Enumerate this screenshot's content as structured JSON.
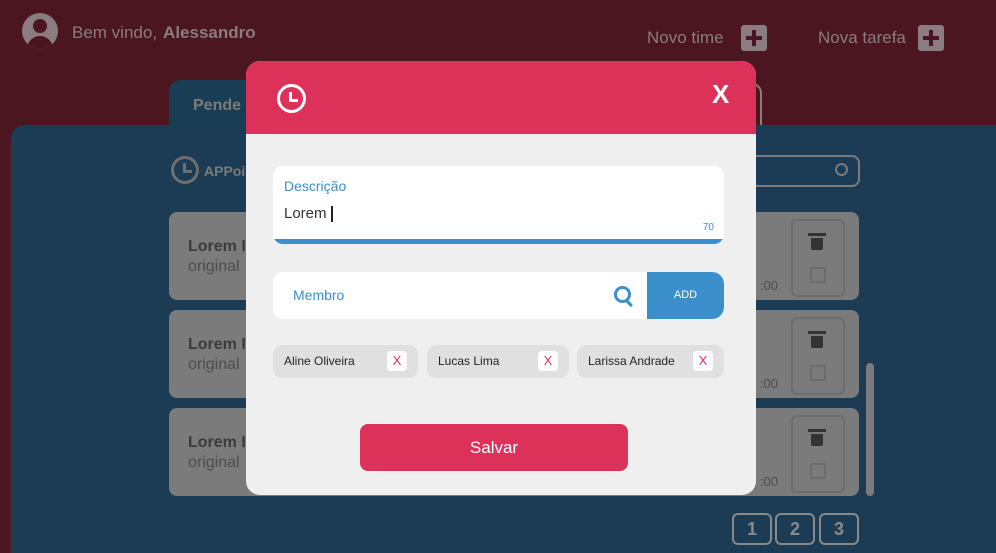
{
  "header": {
    "welcome_prefix": "Bem vindo,",
    "user_name": "Alessandro",
    "new_team_label": "Novo time",
    "new_task_label": "Nova tarefa"
  },
  "tabs": {
    "active_label": "Pende"
  },
  "app": {
    "name": "APPoi"
  },
  "cards": [
    {
      "title": "Lorem I",
      "subtitle": "original",
      "time": ":00"
    },
    {
      "title": "Lorem I",
      "subtitle": "original",
      "time": ":00"
    },
    {
      "title": "Lorem I",
      "subtitle": "original",
      "time": ":00"
    }
  ],
  "pagination": [
    "1",
    "2",
    "3"
  ],
  "modal": {
    "close_label": "X",
    "description_label": "Descrição",
    "description_value": "Lorem",
    "char_count": "70",
    "member_placeholder": "Membro",
    "add_label": "ADD",
    "members": [
      {
        "name": "Aline Oliveira",
        "remove": "X"
      },
      {
        "name": "Lucas Lima",
        "remove": "X"
      },
      {
        "name": "Larissa Andrade",
        "remove": "X"
      }
    ],
    "save_label": "Salvar"
  },
  "colors": {
    "accent": "#dc325a",
    "primary_blue": "#3b8fcb",
    "overlay_bg": "#4b1620"
  }
}
